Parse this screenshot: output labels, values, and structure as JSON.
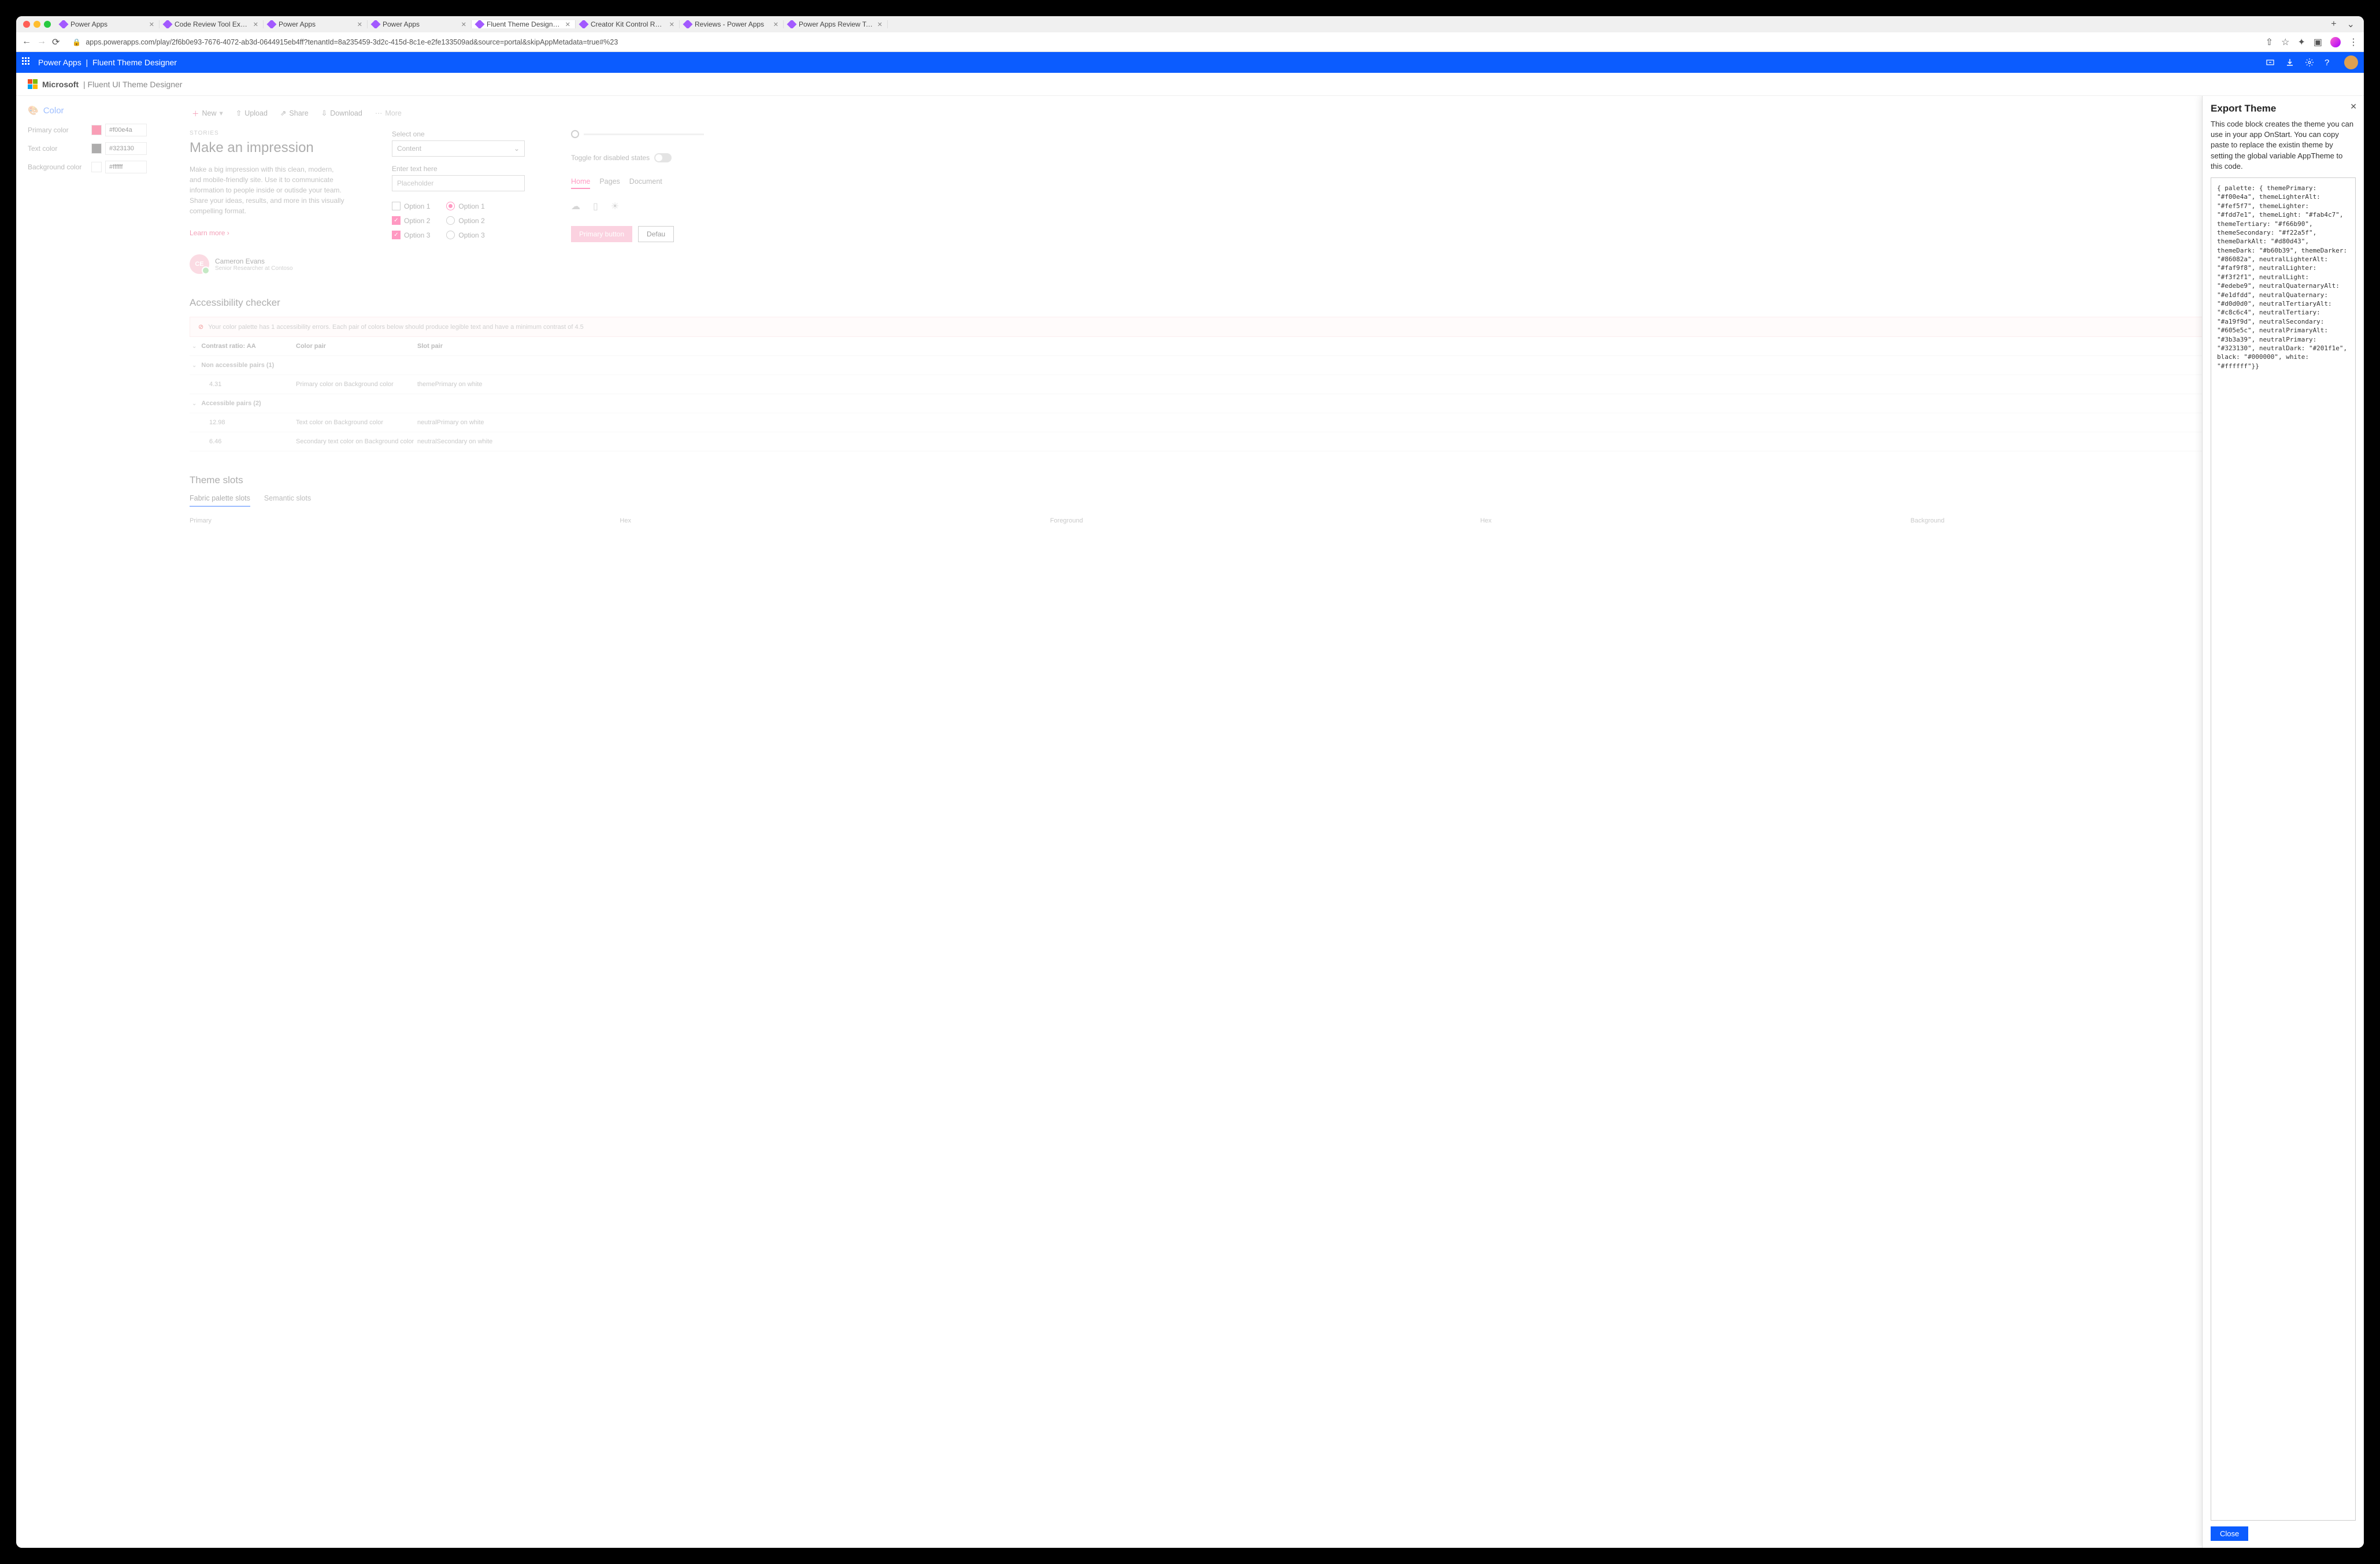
{
  "browser": {
    "tabs": [
      {
        "title": "Power Apps"
      },
      {
        "title": "Code Review Tool Experim"
      },
      {
        "title": "Power Apps"
      },
      {
        "title": "Power Apps"
      },
      {
        "title": "Fluent Theme Designer - P",
        "active": true
      },
      {
        "title": "Creator Kit Control Referen"
      },
      {
        "title": "Reviews - Power Apps"
      },
      {
        "title": "Power Apps Review Tool -"
      }
    ],
    "url": "apps.powerapps.com/play/2f6b0e93-7676-4072-ab3d-0644915eb4ff?tenantId=8a235459-3d2c-415d-8c1e-e2fe133509ad&source=portal&skipAppMetadata=true#%23"
  },
  "appBar": {
    "product": "Power Apps",
    "separator": "|",
    "title": "Fluent Theme Designer"
  },
  "fluentHeader": {
    "brand": "Microsoft",
    "title": "| Fluent UI Theme Designer"
  },
  "sidebar": {
    "header": "Color",
    "rows": [
      {
        "label": "Primary color",
        "hex": "#f00e4a",
        "swatch": "#f00e4a"
      },
      {
        "label": "Text color",
        "hex": "#323130",
        "swatch": "#323130"
      },
      {
        "label": "Background color",
        "hex": "#ffffff",
        "swatch": "#ffffff"
      }
    ]
  },
  "toolbar": {
    "new": "New",
    "upload": "Upload",
    "share": "Share",
    "download": "Download",
    "more": "More"
  },
  "preview": {
    "storiesLabel": "STORIES",
    "headline": "Make an impression",
    "desc": "Make a big impression with this clean, modern, and mobile-friendly site. Use it to communicate information to people inside or outisde your team. Share your ideas, results, and more in this visually compelling format.",
    "learn": "Learn more",
    "persona": {
      "initials": "CE",
      "name": "Cameron Evans",
      "sub": "Senior Researcher at Contoso"
    },
    "selectLabel": "Select one",
    "selectValue": "Content",
    "enterLabel": "Enter text here",
    "enterPlaceholder": "Placeholder",
    "checks": [
      "Option 1",
      "Option 2",
      "Option 3"
    ],
    "radios": [
      "Option 1",
      "Option 2",
      "Option 3"
    ],
    "toggleLabel": "Toggle for disabled states",
    "pivot": [
      "Home",
      "Pages",
      "Document"
    ],
    "primaryBtn": "Primary button",
    "defaultBtn": "Defau"
  },
  "a11y": {
    "header": "Accessibility checker",
    "alert": "Your color palette has 1 accessibility errors. Each pair of colors below should produce legible text and have a minimum contrast of 4.5",
    "cols": {
      "c1": "Contrast ratio: AA",
      "c2": "Color pair",
      "c3": "Slot pair"
    },
    "nonAccHeader": "Non accessible pairs (1)",
    "nonAccRows": [
      {
        "ratio": "4.31",
        "pair": "Primary color on Background color",
        "slot": "themePrimary on white"
      }
    ],
    "accHeader": "Accessible pairs (2)",
    "accRows": [
      {
        "ratio": "12.98",
        "pair": "Text color on Background color",
        "slot": "neutralPrimary on white"
      },
      {
        "ratio": "6.46",
        "pair": "Secondary text color on Background color",
        "slot": "neutralSecondary on white"
      }
    ]
  },
  "slots": {
    "header": "Theme slots",
    "tabs": [
      "Fabric palette slots",
      "Semantic slots"
    ],
    "cols": [
      "Primary",
      "Hex",
      "Foreground",
      "Hex",
      "Background"
    ]
  },
  "panel": {
    "title": "Export Theme",
    "desc": "This code block creates the theme you can use in your app OnStart. You can copy paste to replace the existin theme by setting the global variable AppTheme to this code.",
    "code": "{ palette: { themePrimary: \"#f00e4a\", themeLighterAlt: \"#fef5f7\", themeLighter: \"#fdd7e1\", themeLight: \"#fab4c7\", themeTertiary: \"#f66b90\", themeSecondary: \"#f22a5f\", themeDarkAlt: \"#d80d43\", themeDark: \"#b60b39\", themeDarker: \"#86082a\", neutralLighterAlt: \"#faf9f8\", neutralLighter: \"#f3f2f1\", neutralLight: \"#edebe9\", neutralQuaternaryAlt: \"#e1dfdd\", neutralQuaternary: \"#d0d0d0\", neutralTertiaryAlt: \"#c8c6c4\", neutralTertiary: \"#a19f9d\", neutralSecondary: \"#605e5c\", neutralPrimaryAlt: \"#3b3a39\", neutralPrimary: \"#323130\", neutralDark: \"#201f1e\", black: \"#000000\", white: \"#ffffff\"}}",
    "close": "Close"
  }
}
